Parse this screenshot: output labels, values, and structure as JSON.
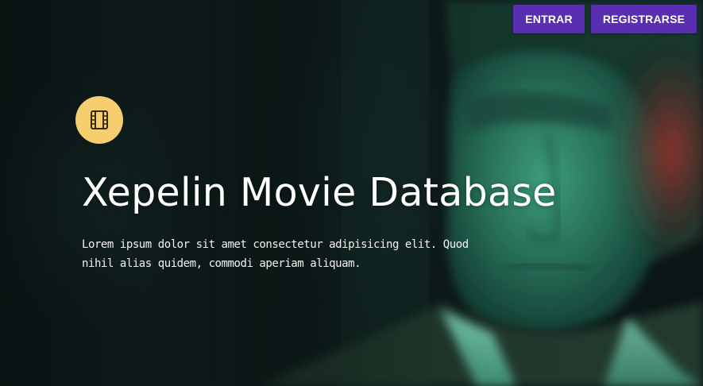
{
  "header": {
    "login_label": "ENTRAR",
    "register_label": "REGISTRARSE"
  },
  "hero": {
    "icon": "film-icon",
    "title": "Xepelin Movie Database",
    "description": "Lorem ipsum dolor sit amet consectetur adipisicing elit. Quod nihil alias quidem, commodi aperiam aliquam."
  },
  "colors": {
    "button_bg": "#5a2eb0",
    "icon_badge": "#f6cd6f",
    "text": "#ffffff"
  }
}
